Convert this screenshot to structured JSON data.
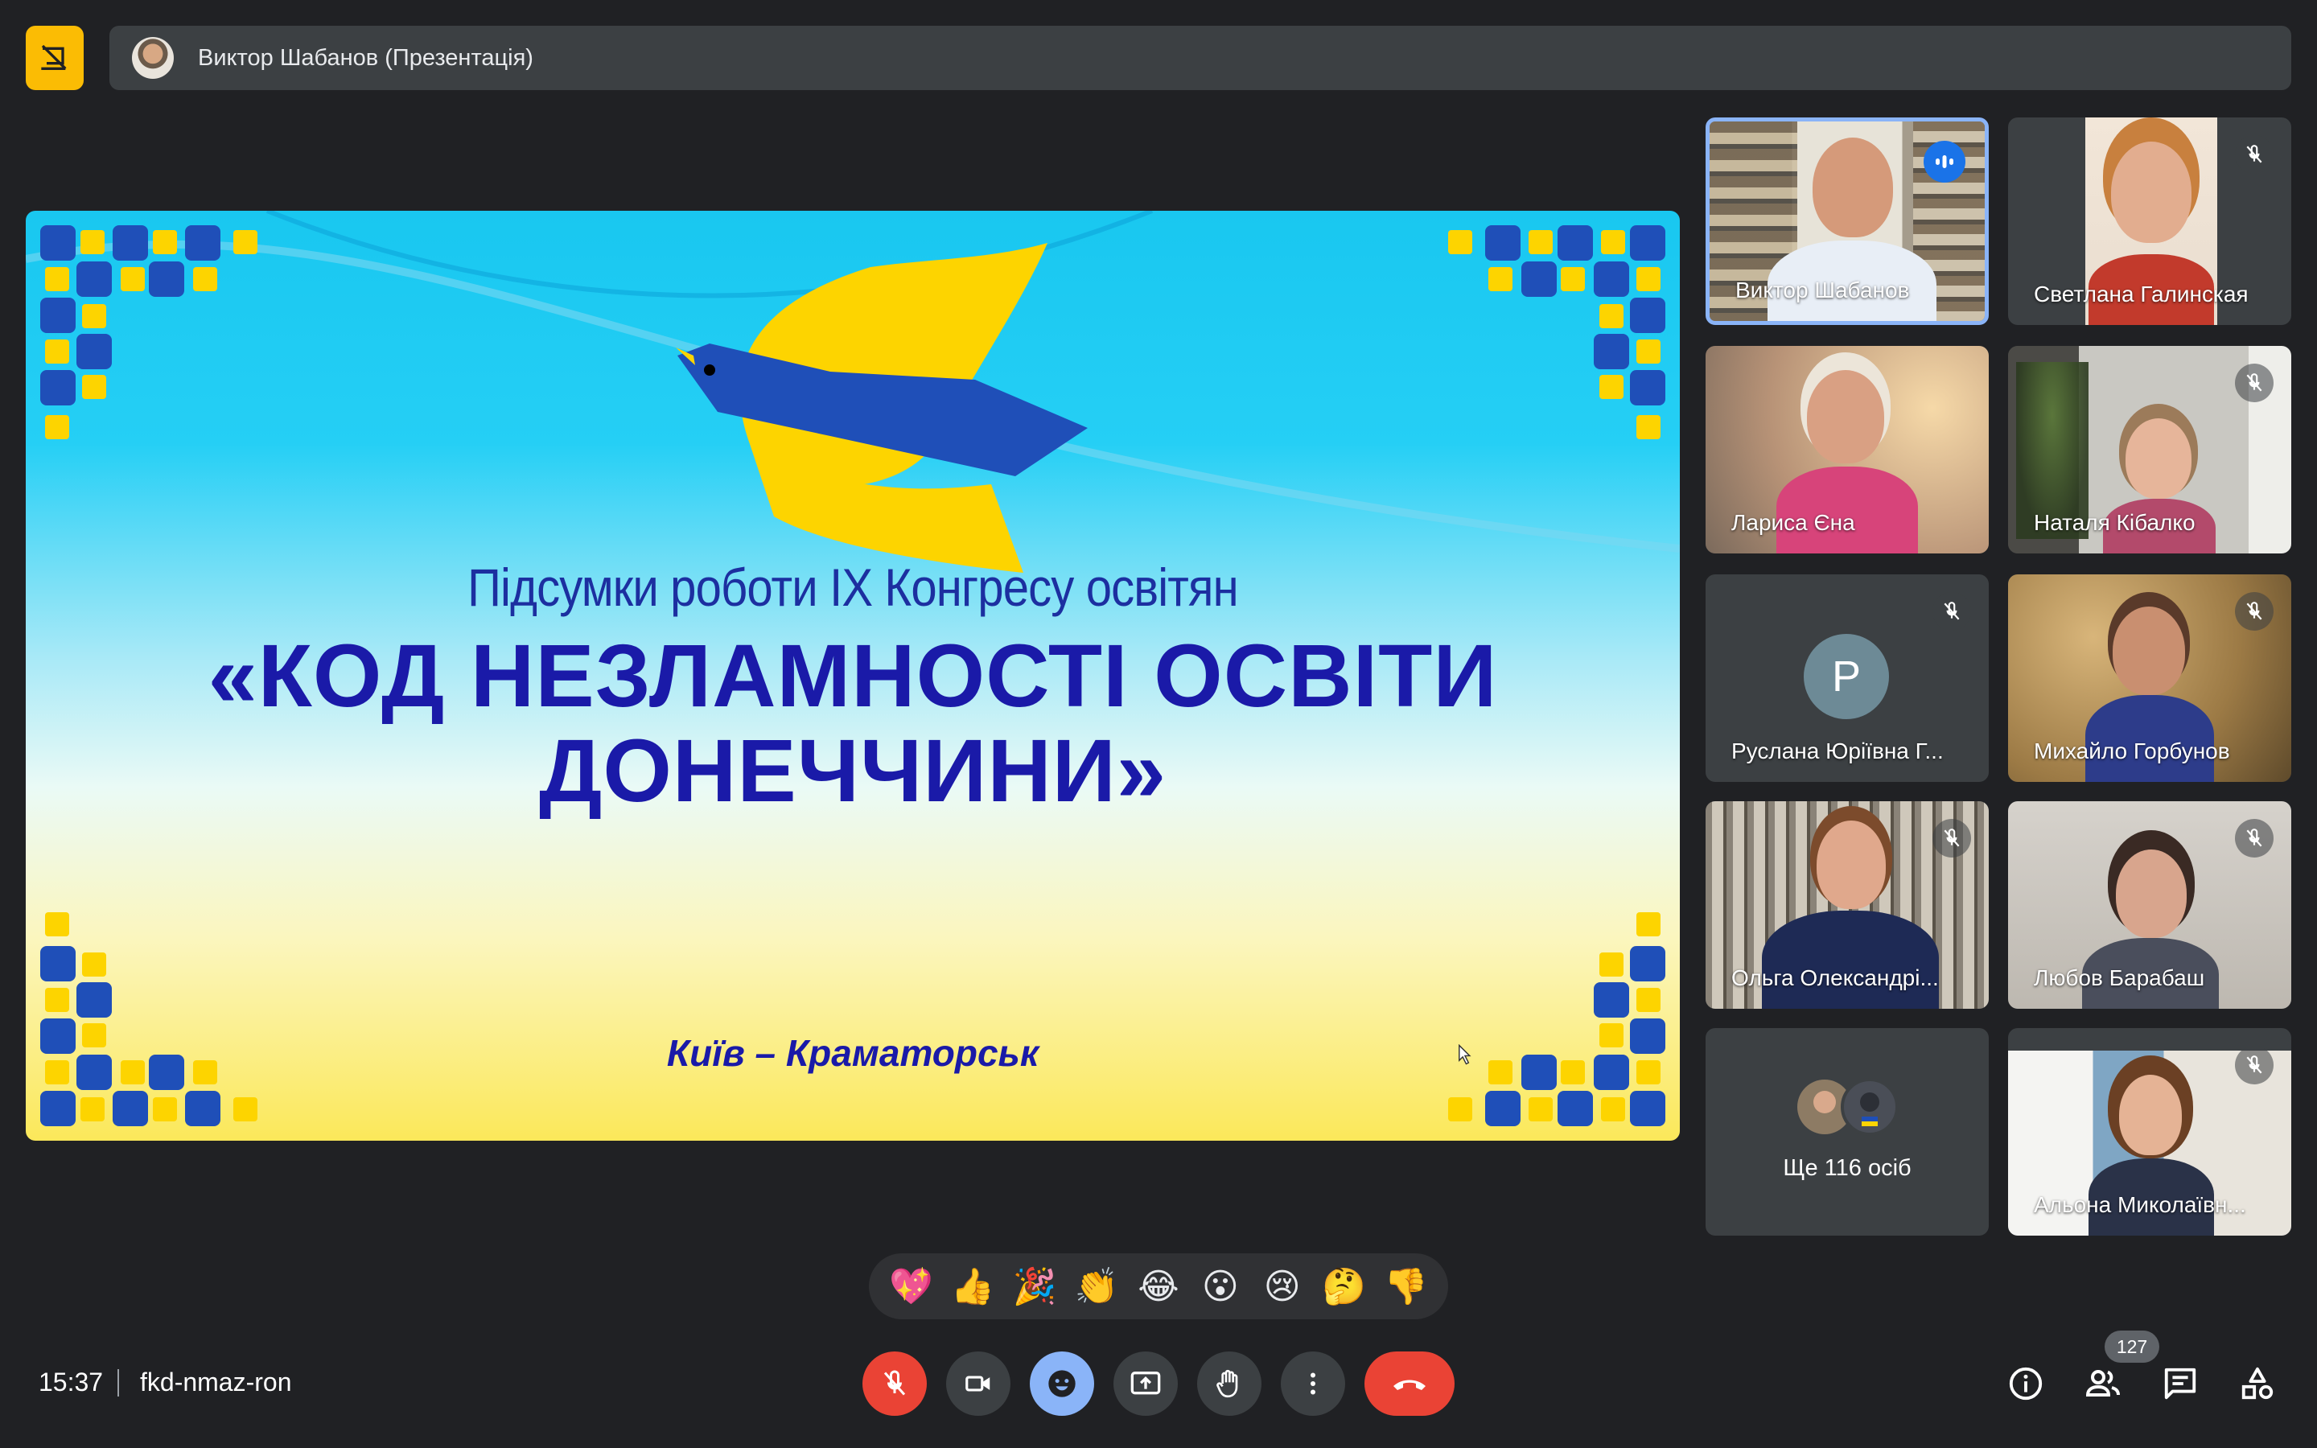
{
  "presentation_bar": {
    "presenter_label": "Виктор Шабанов (Презентація)"
  },
  "slide": {
    "title_line1": "Підсумки роботи IX Конгресу освітян",
    "title_line2": "«КОД НЕЗЛАМНОСТІ ОСВІТИ",
    "title_line3": "ДОНЕЧЧИНИ»",
    "city": "Київ – Краматорськ",
    "colors": {
      "blue": "#1a1aa8",
      "yellow": "#fdd400",
      "sky": "#19c7f0"
    }
  },
  "participants": [
    {
      "name": "Виктор Шабанов",
      "status": "speaking"
    },
    {
      "name": "Светлана Галинская",
      "status": "muted"
    },
    {
      "name": "Лариса Єна",
      "status": "none"
    },
    {
      "name": "Наталя Кібалко",
      "status": "muted"
    },
    {
      "name": "Руслана Юріївна Г...",
      "status": "muted",
      "avatar_letter": "Р"
    },
    {
      "name": "Михайло Горбунов",
      "status": "muted"
    },
    {
      "name": "Ольга Олександрі...",
      "status": "muted"
    },
    {
      "name": "Любов Барабаш",
      "status": "muted"
    },
    {
      "name": "Альона Миколаївн...",
      "status": "muted"
    }
  ],
  "more_participants": {
    "label": "Ще 116 осіб"
  },
  "reactions": [
    "💖",
    "👍",
    "🎉",
    "👏",
    "😂",
    "😮",
    "😢",
    "🤔",
    "👎"
  ],
  "bottom_bar": {
    "time": "15:37",
    "meeting_code": "fkd-nmaz-ron",
    "people_count": "127"
  },
  "icons": {
    "present_badge": "stop-presenting-icon",
    "mic": "mic-off-icon",
    "camera": "camera-icon",
    "emoji": "emoji-icon",
    "present": "present-screen-icon",
    "hand": "raise-hand-icon",
    "more": "more-vert-icon",
    "hangup": "call-end-icon",
    "info": "info-icon",
    "people": "people-icon",
    "chat": "chat-icon",
    "activities": "activities-icon"
  }
}
